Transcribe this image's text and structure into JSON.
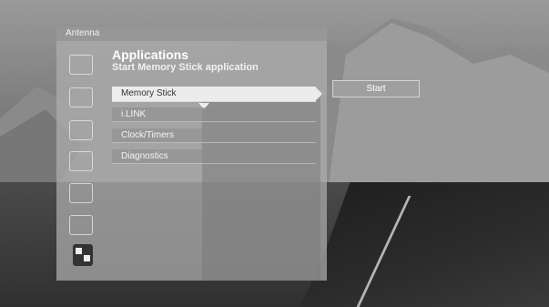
{
  "header": {
    "title": "Antenna"
  },
  "app": {
    "title": "Applications",
    "subtitle": "Start Memory Stick application"
  },
  "menu": {
    "items": [
      {
        "label": "Memory Stick",
        "selected": true
      },
      {
        "label": "i.LINK",
        "selected": false
      },
      {
        "label": "Clock/Timers",
        "selected": false
      },
      {
        "label": "Diagnostics",
        "selected": false
      }
    ]
  },
  "action": {
    "start_label": "Start"
  },
  "sidebar": {
    "icons": [
      "antenna-icon",
      "tools-icon",
      "picture-icon",
      "sound-icon",
      "speaker-icon",
      "tv-icon",
      "applications-icon"
    ]
  }
}
